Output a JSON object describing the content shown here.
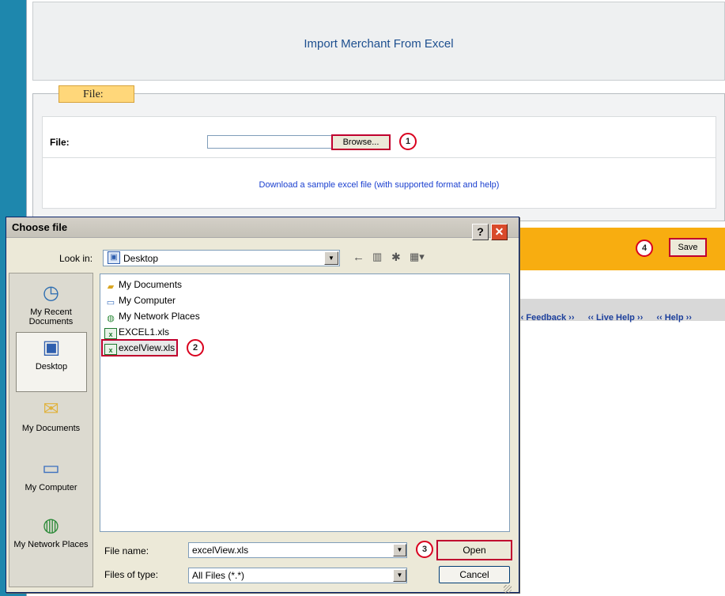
{
  "page": {
    "title": "Import Merchant From Excel",
    "legend": "File:",
    "file_label": "File:",
    "browse_label": "Browse...",
    "download_link": "Download a sample excel file (with supported format and help)",
    "save_label": "Save",
    "footer_links": [
      "‹‹ Feedback ››",
      "‹‹ Live Help ››",
      "‹‹ Help ››"
    ],
    "accent_color": "#f8ad10"
  },
  "markers": [
    "1",
    "2",
    "3",
    "4"
  ],
  "dialog": {
    "title": "Choose file",
    "help_icon": "?",
    "close_icon": "✕",
    "look_in_label": "Look in:",
    "look_in_value": "Desktop",
    "places": [
      {
        "label": "My Recent Documents",
        "icon": "recent-documents-icon"
      },
      {
        "label": "Desktop",
        "icon": "desktop-icon"
      },
      {
        "label": "My Documents",
        "icon": "my-documents-icon"
      },
      {
        "label": "My Computer",
        "icon": "my-computer-icon"
      },
      {
        "label": "My Network Places",
        "icon": "network-places-icon"
      }
    ],
    "files": [
      {
        "name": "My Documents",
        "icon": "folder-icon"
      },
      {
        "name": "My Computer",
        "icon": "computer-icon"
      },
      {
        "name": "My Network Places",
        "icon": "network-icon"
      },
      {
        "name": "EXCEL1.xls",
        "icon": "excel-file-icon"
      },
      {
        "name": "excelView.xls",
        "icon": "excel-file-icon",
        "selected": true
      }
    ],
    "file_name_label": "File name:",
    "file_name_value": "excelView.xls",
    "file_type_label": "Files of type:",
    "file_type_value": "All Files (*.*)",
    "open_label": "Open",
    "cancel_label": "Cancel"
  }
}
